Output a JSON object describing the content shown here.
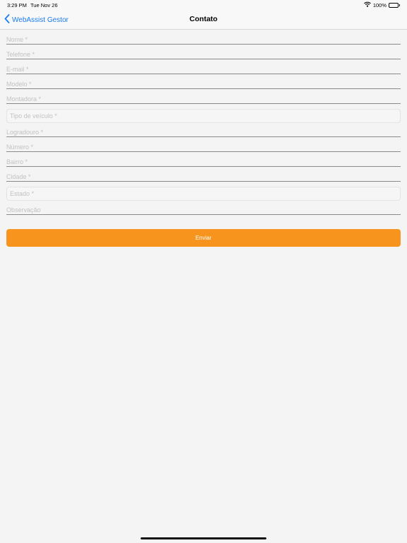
{
  "status_bar": {
    "time": "3:29 PM",
    "date": "Tue Nov 26",
    "battery": "100%",
    "icons": [
      "wifi-icon",
      "battery-icon"
    ]
  },
  "nav": {
    "back_label": "WebAssist Gestor",
    "title": "Contato",
    "accent_color": "#1a7cf4"
  },
  "form": {
    "nome": "Nome *",
    "telefone": "Telefone *",
    "email": "E-mail *",
    "modelo": "Modelo *",
    "montadora": "Montadora *",
    "tipo_veiculo": "Tipo de veículo *",
    "logradouro": "Logradouro *",
    "numero": "Número *",
    "bairro": "Bairro *",
    "cidade": "Cidade *",
    "estado": "Estado *",
    "observacao": "Observação"
  },
  "submit": {
    "label": "Enviar",
    "color": "#f7941e"
  }
}
